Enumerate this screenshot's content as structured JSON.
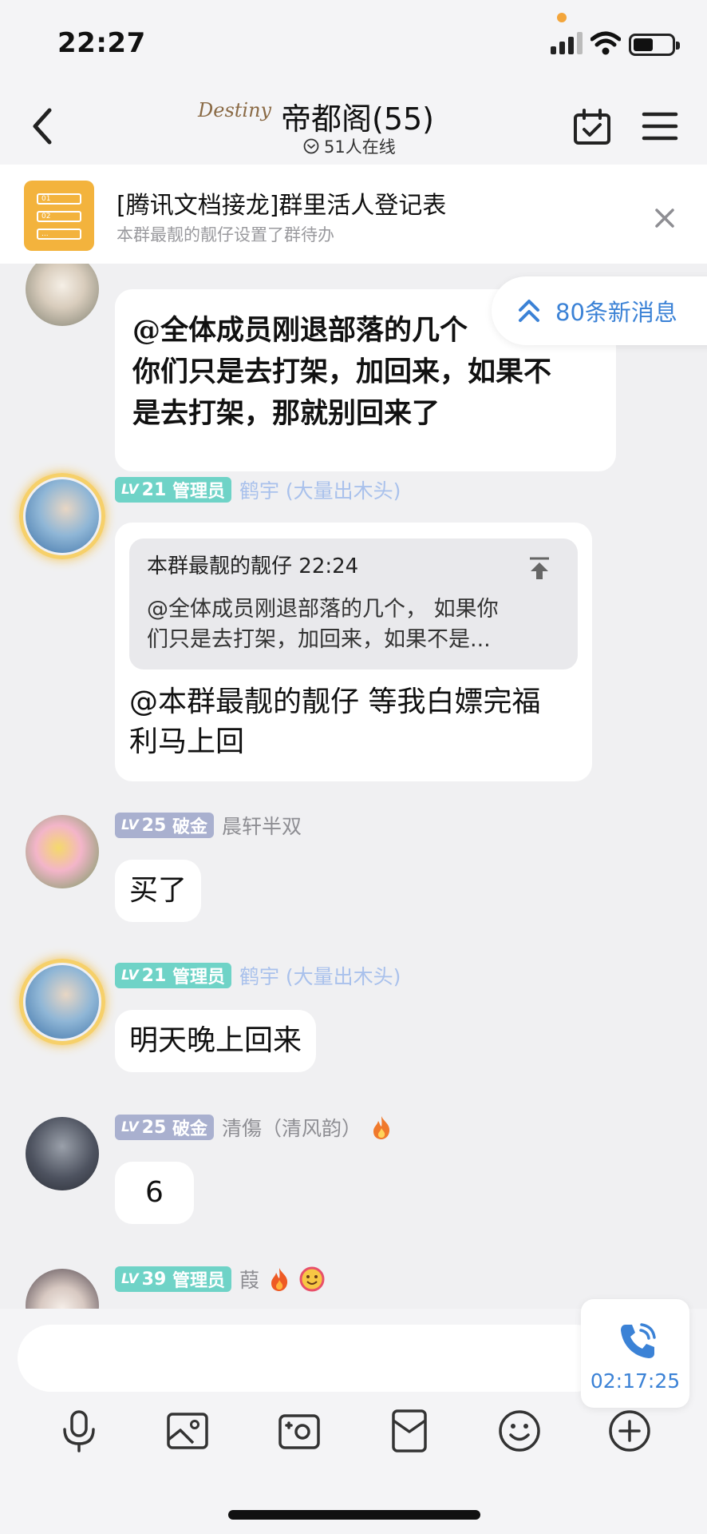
{
  "status_bar": {
    "time": "22:27"
  },
  "header": {
    "logo_text": "Destiny",
    "title": "帝都阁(55)",
    "online_text": "51人在线"
  },
  "todo_banner": {
    "title": "[腾讯文档接龙]群里活人登记表",
    "subtitle": "本群最靓的靓仔设置了群待办",
    "icon_lines": [
      "01",
      "02",
      "..."
    ]
  },
  "new_messages": {
    "label": "80条新消息"
  },
  "messages": [
    {
      "text_lines": [
        "@全体成员刚退部落的几个",
        "你们只是去打架，加回来，如果不",
        "是去打架，那就别回来了"
      ]
    },
    {
      "level": "21",
      "role": "管理员",
      "name": "鹤宇 (大量出木头)",
      "quote": {
        "author": "本群最靓的靓仔",
        "time": "22:24",
        "text_lines": [
          "@全体成员刚退部落的几个， 如果你",
          "们只是去打架，加回来，如果不是..."
        ]
      },
      "text_lines": [
        "@本群最靓的靓仔 等我白嫖完福",
        "利马上回"
      ]
    },
    {
      "level": "25",
      "role": "破金",
      "name": "晨轩半双",
      "text": "买了"
    },
    {
      "level": "21",
      "role": "管理员",
      "name": "鹤宇 (大量出木头)",
      "text": "明天晚上回来"
    },
    {
      "level": "25",
      "role": "破金",
      "name": "清傷（清风韵）",
      "text": "6"
    },
    {
      "level": "39",
      "role": "管理员",
      "name": "葭"
    }
  ],
  "call": {
    "duration": "02:17:25"
  },
  "lv_prefix": "LV",
  "colors": {
    "accent_blue": "#3b82d6",
    "level_teal": "#6fd3c7",
    "level_purple": "#a9b0cf",
    "todo_yellow": "#f3b33d"
  }
}
